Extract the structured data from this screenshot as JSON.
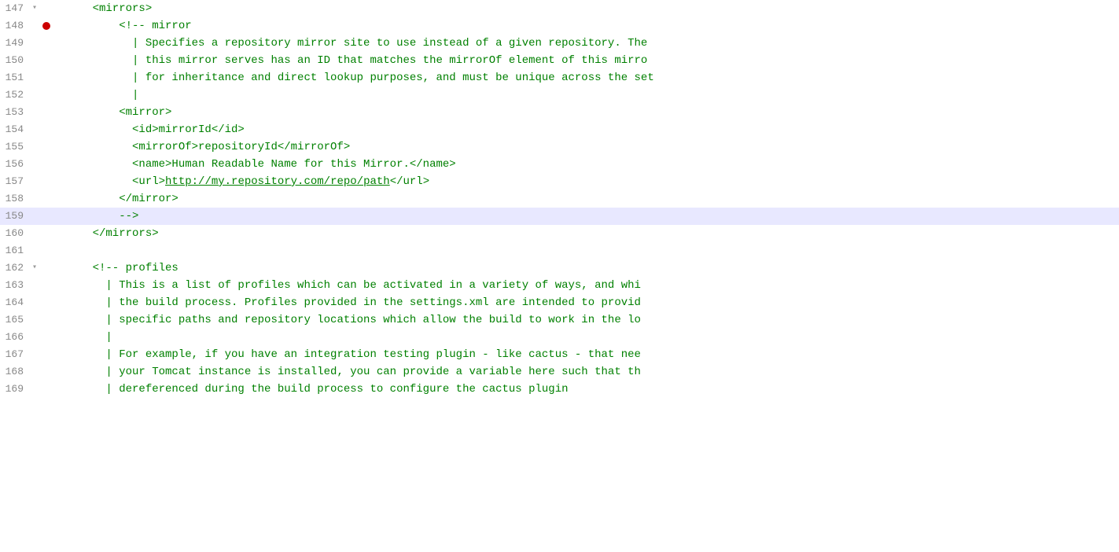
{
  "editor": {
    "background": "#ffffff",
    "highlight_line": 159,
    "lines": [
      {
        "num": 147,
        "fold": "▾",
        "breakpoint": false,
        "indent": 0,
        "content": [
          {
            "type": "tag",
            "text": "    <mirrors>"
          }
        ]
      },
      {
        "num": 148,
        "fold": "",
        "breakpoint": true,
        "indent": 0,
        "content": [
          {
            "type": "comment",
            "text": "        <!-- mirror"
          }
        ]
      },
      {
        "num": 149,
        "fold": "",
        "breakpoint": false,
        "indent": 0,
        "content": [
          {
            "type": "comment",
            "text": "          | Specifies a repository mirror site to use instead of a given repository. The"
          }
        ]
      },
      {
        "num": 150,
        "fold": "",
        "breakpoint": false,
        "indent": 0,
        "content": [
          {
            "type": "comment",
            "text": "          | this mirror serves has an ID that matches the mirrorOf element of this mirro"
          }
        ]
      },
      {
        "num": 151,
        "fold": "",
        "breakpoint": false,
        "indent": 0,
        "content": [
          {
            "type": "comment",
            "text": "          | for inheritance and direct lookup purposes, and must be unique across the set"
          }
        ]
      },
      {
        "num": 152,
        "fold": "",
        "breakpoint": false,
        "indent": 0,
        "content": [
          {
            "type": "comment",
            "text": "          |"
          }
        ]
      },
      {
        "num": 153,
        "fold": "",
        "breakpoint": false,
        "indent": 0,
        "content": [
          {
            "type": "tag",
            "text": "        <mirror>"
          }
        ]
      },
      {
        "num": 154,
        "fold": "",
        "breakpoint": false,
        "indent": 0,
        "content": [
          {
            "type": "tag",
            "text": "          <id>mirrorId</id>"
          }
        ]
      },
      {
        "num": 155,
        "fold": "",
        "breakpoint": false,
        "indent": 0,
        "content": [
          {
            "type": "tag",
            "text": "          <mirrorOf>repositoryId</mirrorOf>"
          }
        ]
      },
      {
        "num": 156,
        "fold": "",
        "breakpoint": false,
        "indent": 0,
        "content": [
          {
            "type": "tag",
            "text": "          <name>Human Readable Name for this Mirror.</name>"
          }
        ]
      },
      {
        "num": 157,
        "fold": "",
        "breakpoint": false,
        "indent": 0,
        "content": [
          {
            "type": "tag",
            "text": "          <url>"
          },
          {
            "type": "url",
            "text": "http://my.repository.com/repo/path"
          },
          {
            "type": "tag",
            "text": "</url>"
          }
        ]
      },
      {
        "num": 158,
        "fold": "",
        "breakpoint": false,
        "indent": 0,
        "content": [
          {
            "type": "tag",
            "text": "        </mirror>"
          }
        ]
      },
      {
        "num": 159,
        "fold": "",
        "breakpoint": false,
        "highlighted": true,
        "indent": 0,
        "content": [
          {
            "type": "comment",
            "text": "        -->"
          }
        ]
      },
      {
        "num": 160,
        "fold": "",
        "breakpoint": false,
        "indent": 0,
        "content": [
          {
            "type": "tag",
            "text": "    </mirrors>"
          }
        ]
      },
      {
        "num": 161,
        "fold": "",
        "breakpoint": false,
        "indent": 0,
        "content": [
          {
            "type": "text",
            "text": ""
          }
        ]
      },
      {
        "num": 162,
        "fold": "▾",
        "breakpoint": false,
        "indent": 0,
        "content": [
          {
            "type": "comment",
            "text": "    <!-- profiles"
          }
        ]
      },
      {
        "num": 163,
        "fold": "",
        "breakpoint": false,
        "indent": 0,
        "content": [
          {
            "type": "comment",
            "text": "      | This is a list of profiles which can be activated in a variety of ways, and whi"
          }
        ]
      },
      {
        "num": 164,
        "fold": "",
        "breakpoint": false,
        "indent": 0,
        "content": [
          {
            "type": "comment",
            "text": "      | the build process. Profiles provided in the settings.xml are intended to provid"
          }
        ]
      },
      {
        "num": 165,
        "fold": "",
        "breakpoint": false,
        "indent": 0,
        "content": [
          {
            "type": "comment",
            "text": "      | specific paths and repository locations which allow the build to work in the lo"
          }
        ]
      },
      {
        "num": 166,
        "fold": "",
        "breakpoint": false,
        "indent": 0,
        "content": [
          {
            "type": "comment",
            "text": "      |"
          }
        ]
      },
      {
        "num": 167,
        "fold": "",
        "breakpoint": false,
        "indent": 0,
        "content": [
          {
            "type": "comment",
            "text": "      | For example, if you have an integration testing plugin - like cactus - that nee"
          }
        ]
      },
      {
        "num": 168,
        "fold": "",
        "breakpoint": false,
        "indent": 0,
        "content": [
          {
            "type": "comment",
            "text": "      | your Tomcat instance is installed, you can provide a variable here such that th"
          }
        ]
      },
      {
        "num": 169,
        "fold": "",
        "breakpoint": false,
        "indent": 0,
        "content": [
          {
            "type": "comment",
            "text": "      | dereferenced during the build process to configure the cactus plugin"
          }
        ]
      }
    ]
  }
}
